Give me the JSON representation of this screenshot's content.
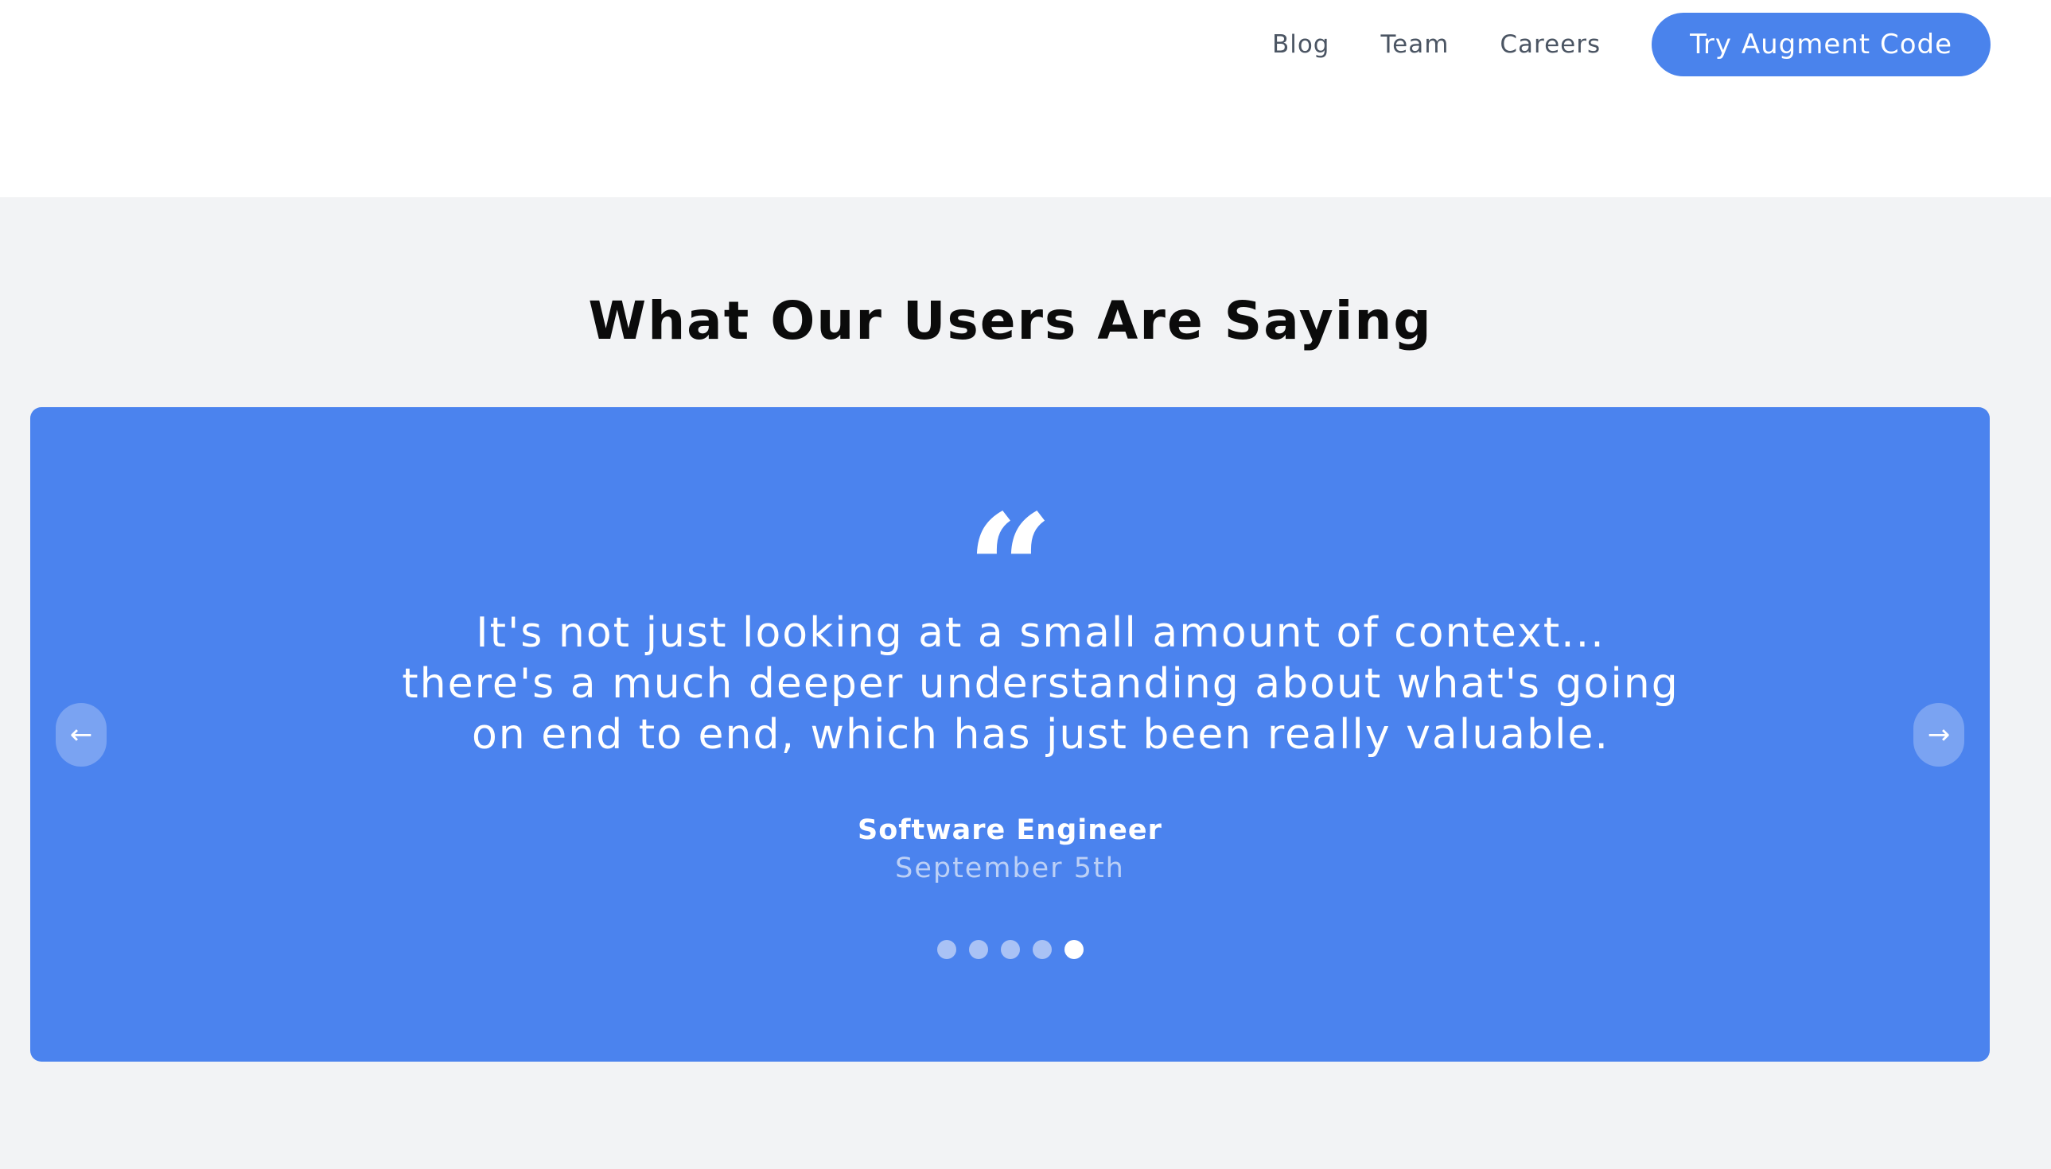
{
  "nav": {
    "links": [
      "Blog",
      "Team",
      "Careers"
    ],
    "cta_label": "Try Augment Code"
  },
  "section": {
    "title": "What Our Users Are Saying"
  },
  "testimonial": {
    "quote_mark": "“",
    "quote": "It's not just looking at a small amount of context... there's a much deeper understanding about what's going on end to end, which has just been really valuable.",
    "author": "Software Engineer",
    "date": "September 5th",
    "prev_arrow": "←",
    "next_arrow": "→",
    "pagination": {
      "total": 5,
      "active_index": 4
    }
  },
  "colors": {
    "accent": "#4a83ec",
    "card_background": "#4b83ee",
    "page_background": "#f2f3f5",
    "header_background": "#ffffff"
  }
}
